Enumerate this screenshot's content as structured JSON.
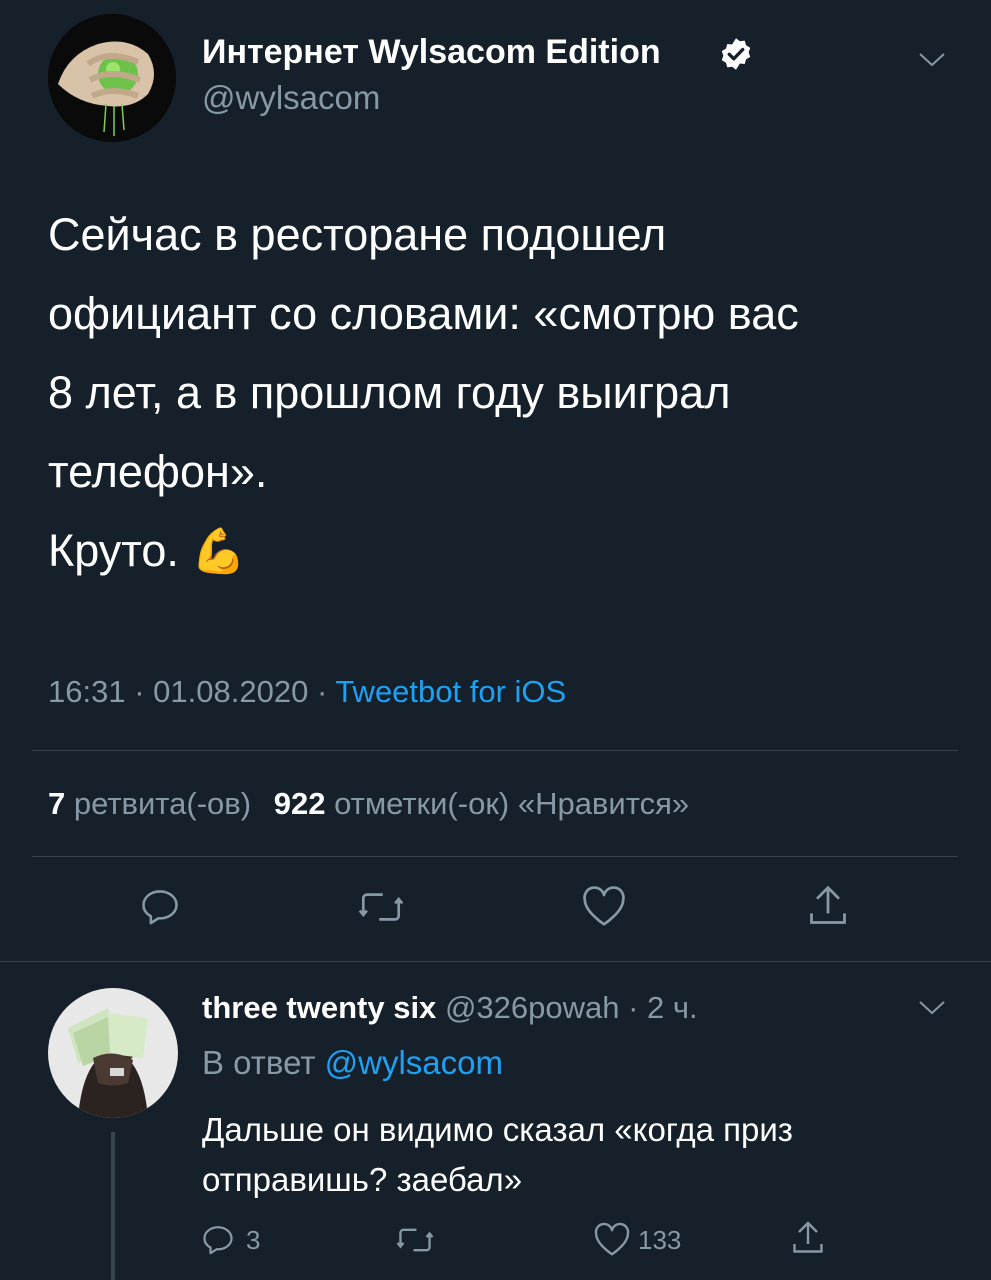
{
  "tweet": {
    "author_name": "Интернет Wylsacom Edition",
    "author_handle": "@wylsacom",
    "text_lines": [
      "Сейчас в ресторане подошел",
      "официант со словами: «смотрю вас",
      "8 лет, а в прошлом году выиграл",
      "телефон».",
      "Круто."
    ],
    "emoji": "💪",
    "time": "16:31",
    "date": "01.08.2020",
    "source": "Tweetbot for iOS",
    "separator": "·",
    "retweets_count": "7",
    "retweets_label": "ретвита(-ов)",
    "likes_count": "922",
    "likes_label": "отметки(-ок) «Нравится»"
  },
  "reply": {
    "author_name": "three twenty six",
    "author_handle": "@326powah",
    "age": "· 2 ч.",
    "in_reply_prefix": "В ответ",
    "in_reply_to": "@wylsacom",
    "text_lines": [
      "Дальше он видимо сказал «когда приз",
      "отправишь? заебал»"
    ],
    "replies_count": "3",
    "likes_count": "133"
  },
  "colors": {
    "background": "#15202b",
    "muted": "#8899a6",
    "accent": "#1da1f2",
    "divider": "#38444d"
  },
  "icons": [
    "verified-badge-icon",
    "chevron-down-icon",
    "reply-icon",
    "retweet-icon",
    "like-icon",
    "share-icon"
  ]
}
